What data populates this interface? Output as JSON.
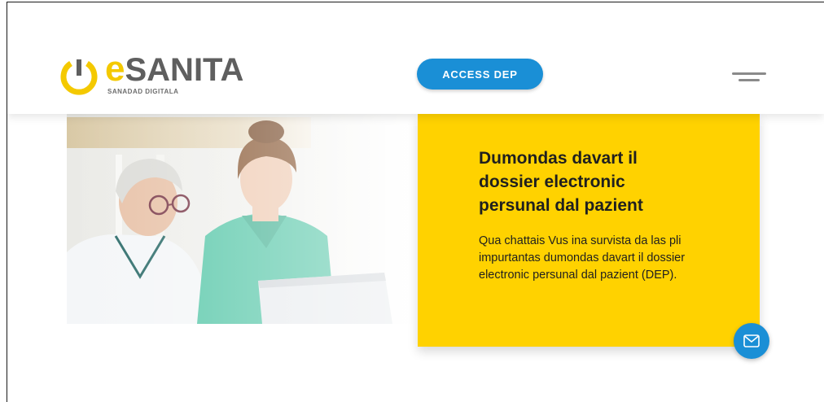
{
  "logo": {
    "brand_prefix": "e",
    "brand_name": "SANITA",
    "tagline": "SANADAD DIGITALA",
    "power_icon": "power-icon"
  },
  "header": {
    "access_button_label": "ACCESS DEP",
    "menu_icon": "hamburger-menu-icon"
  },
  "hero": {
    "image": "doctor-and-nurse-photo",
    "title": "Dumondas davart il dossier electronic persunal dal pazient",
    "text": "Qua chattais Vus ina survista da las pli impurtantas dumondas davart il dossier electronic persunal dal pazient (DEP)."
  },
  "contact": {
    "icon": "mail-icon"
  },
  "colors": {
    "brand_yellow": "#ffd200",
    "logo_yellow": "#f4c900",
    "button_blue": "#1a8fd6",
    "text_dark": "#1f1f1f",
    "logo_gray": "#5f5f5f"
  }
}
